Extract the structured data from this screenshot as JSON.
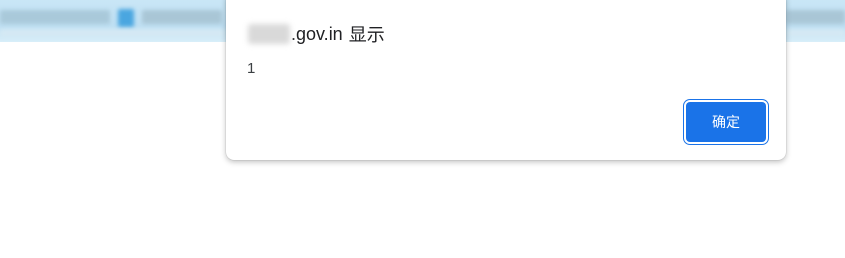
{
  "dialog": {
    "origin": ".gov.in",
    "shows_label": "显示",
    "message": "1",
    "ok_label": "确定"
  },
  "colors": {
    "header_background": "#c9e6f6",
    "button_primary": "#1a73e8",
    "dialog_background": "#ffffff"
  }
}
